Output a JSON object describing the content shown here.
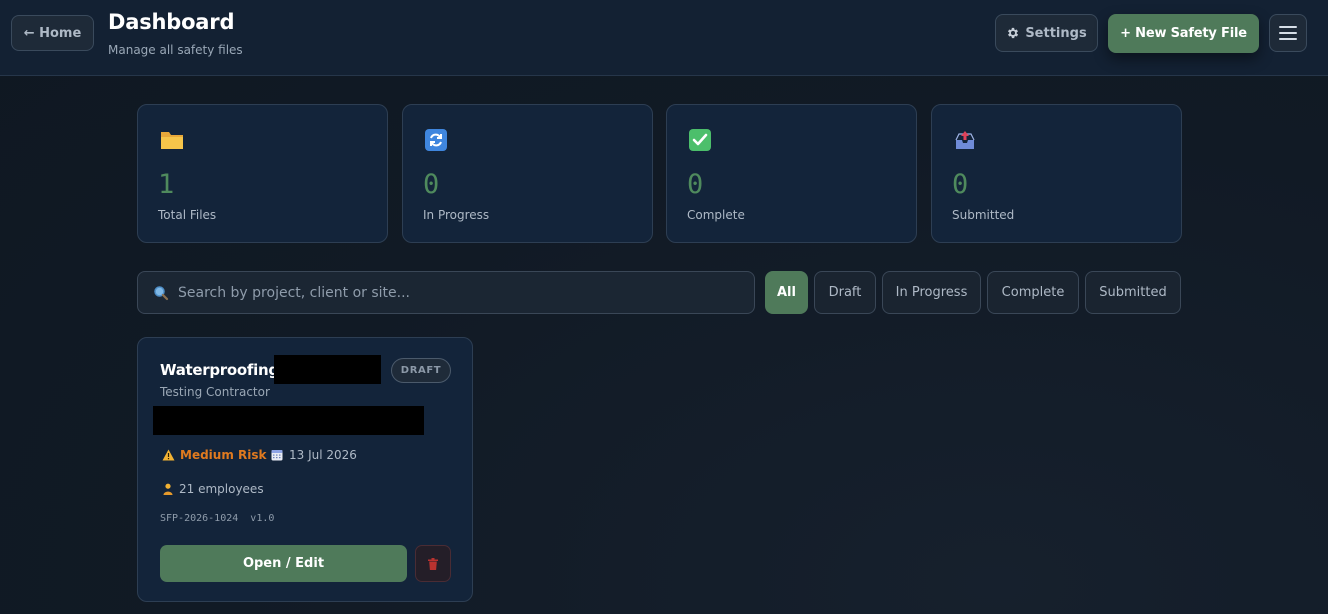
{
  "header": {
    "home_label": "← Home",
    "title": "Dashboard",
    "subtitle": "Manage all safety files",
    "settings_label": "Settings",
    "settings_icon": "gear-icon",
    "new_file_label": "+ New Safety File",
    "menu_icon": "hamburger-icon"
  },
  "stats": [
    {
      "icon": "folder-icon",
      "value": "1",
      "label": "Total Files"
    },
    {
      "icon": "refresh-icon",
      "value": "0",
      "label": "In Progress"
    },
    {
      "icon": "check-icon",
      "value": "0",
      "label": "Complete"
    },
    {
      "icon": "outbox-icon",
      "value": "0",
      "label": "Submitted"
    }
  ],
  "search": {
    "placeholder": "Search by project, client or site...",
    "value": ""
  },
  "filters": {
    "selected": "All",
    "options": [
      "All",
      "Draft",
      "In Progress",
      "Complete",
      "Submitted"
    ]
  },
  "files": [
    {
      "title": "Waterproofing",
      "status": "DRAFT",
      "client": "Testing Contractor",
      "risk": "Medium Risk",
      "date": "13 Jul 2026",
      "employees": "21 employees",
      "reference": "SFP-2026-1024  v1.0",
      "open_label": "Open / Edit",
      "delete_icon": "trash-icon"
    }
  ],
  "colors": {
    "accent": "#4f7a5a",
    "stat_number": "#4f8a5d",
    "risk_medium": "#e07a1f",
    "card_background": "#13243a",
    "page_background": "#111a25"
  }
}
